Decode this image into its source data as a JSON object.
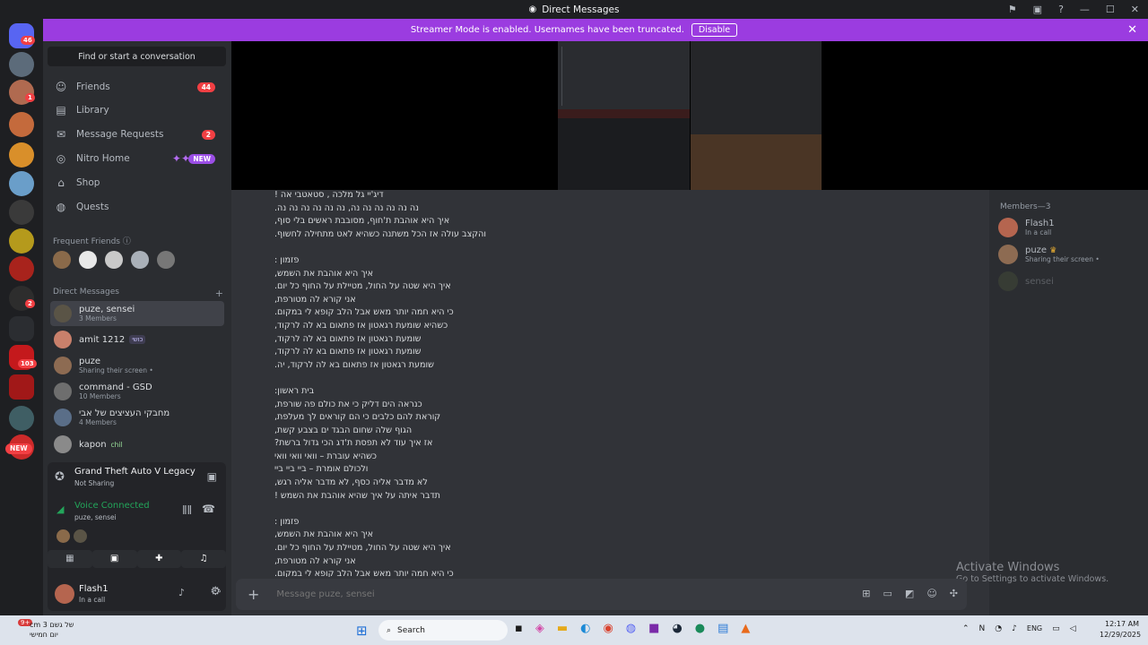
{
  "window": {
    "title": "Direct Messages"
  },
  "banner": {
    "text": "Streamer Mode is enabled. Usernames have been truncated.",
    "disable_label": "Disable"
  },
  "servers": {
    "home_badge": "46",
    "badges": [
      "1",
      "2",
      "103"
    ],
    "new_label": "NEW"
  },
  "sidebar": {
    "search_placeholder": "Find or start a conversation",
    "nav": [
      {
        "label": "Friends",
        "icon": "friends-icon",
        "count": "44"
      },
      {
        "label": "Library",
        "icon": "library-icon",
        "count": ""
      },
      {
        "label": "Message Requests",
        "icon": "mail-icon",
        "count": "2"
      },
      {
        "label": "Nitro Home",
        "icon": "nitro-icon",
        "count": "",
        "tag": "NEW"
      },
      {
        "label": "Shop",
        "icon": "shop-icon",
        "count": ""
      },
      {
        "label": "Quests",
        "icon": "quests-icon",
        "count": ""
      }
    ],
    "frequent_friends_label": "Frequent Friends",
    "direct_messages_label": "Direct Messages",
    "dms": [
      {
        "name": "puze, sensei",
        "sub": "3 Members",
        "tag": ""
      },
      {
        "name": "amit 1212",
        "sub": "",
        "tag": "כושי"
      },
      {
        "name": "puze",
        "sub": "Sharing their screen •",
        "tag": ""
      },
      {
        "name": "command - GSD",
        "sub": "10 Members",
        "tag": ""
      },
      {
        "name": "מחבקי העציצים של אבי",
        "sub": "4 Members",
        "tag": ""
      },
      {
        "name": "kapon",
        "sub": "",
        "tag": "chil"
      }
    ]
  },
  "activity": {
    "game": "Grand Theft Auto V Legacy",
    "status": "Not Sharing"
  },
  "voice": {
    "status": "Voice Connected",
    "channel": "puze, sensei"
  },
  "user": {
    "name": "Flash1",
    "status": "In a call"
  },
  "chat": {
    "lines": [
      "דיג'יי גל מלכה , סטאטבי אה !",
      "נה נה נה נה נה נה, נה נה נה נה נה נה.",
      "איך היא אוהבת ת'חוף, מסובבת ראשים בלי סוף,",
      "והקצב עולה אז הכל משתנה כשהיא לאט מתחילה לחשוף.",
      "",
      "פזמון :",
      "איך היא אוהבת את השמש,",
      "איך היא שטה על החול, מטיילת על החוף כל יום.",
      "אני קורא לה מטורפת,",
      "כי היא חמה יותר מאש אבל הלב קופא לי במקום.",
      "כשהיא שומעת רגאטון אז פתאום בא לה לרקוד,",
      "שומעת רגאטון אז פתאום בא לה לרקוד,",
      "שומעת רגאטון אז פתאום בא לה לרקוד,",
      "שומעת רגאטון אז פתאום בא לה לרקוד, יה.",
      "",
      "בית ראשון:",
      "כנראה הים דליק כי את כולם פה שורפת,",
      "קוראת להם כלבים כי הם קוראים לך מעלפת,",
      "הגוף שלה שחום הבגד ים בצבע קשת,",
      "אז איך עוד לא תפסת ת'דג הכי גדול ברשת?",
      "כשהיא עוברת – וואי וואי וואי",
      "ולכולם אומרת – ביי ביי ביי",
      "לא מדבר אליה כסף, לא מדבר אליה רגש,",
      "תדבר איתה על איך שהיא אוהבת את השמש !",
      "",
      "פזמון :",
      "איך היא אוהבת את השמש,",
      "איך היא שטה על החול, מטיילת על החוף כל יום.",
      "אני קורא לה מטורפת,",
      "כי היא חמה יותר מאש אבל הלב קופא לי במקום."
    ],
    "placeholder": "Message puze, sensei"
  },
  "members": {
    "header": "Members—3",
    "list": [
      {
        "name": "Flash1",
        "sub": "In a call"
      },
      {
        "name": "puze",
        "sub": "Sharing their screen •"
      },
      {
        "name": "sensei",
        "sub": ""
      }
    ]
  },
  "watermark": {
    "title": "Activate Windows",
    "sub": "Go to Settings to activate Windows."
  },
  "taskbar": {
    "weather_line1": "של גשם 3 cm",
    "weather_line2": "יום חמישי",
    "weather_badge": "9+",
    "search_label": "Search",
    "lang": "ENG",
    "time": "12:17 AM",
    "date": "12/29/2025"
  }
}
